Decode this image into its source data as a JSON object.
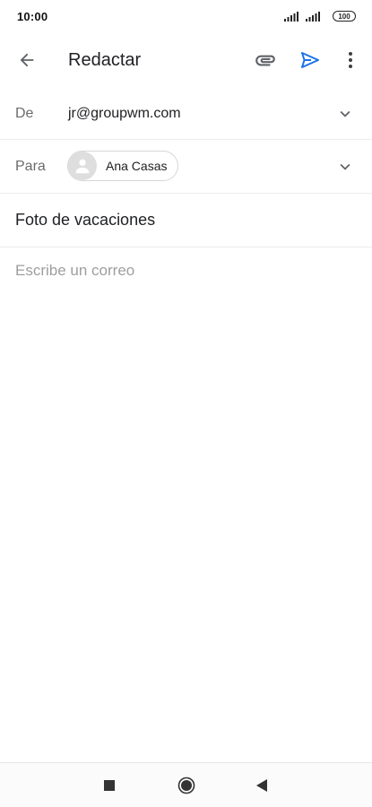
{
  "status_bar": {
    "time": "10:00",
    "battery": "100"
  },
  "app_bar": {
    "title": "Redactar",
    "icons": {
      "back": "arrow-back-icon",
      "attach": "paperclip-icon",
      "send": "send-icon",
      "more": "more-vert-icon"
    },
    "send_color": "#1a73e8"
  },
  "compose": {
    "from_label": "De",
    "from_value": "jr@groupwm.com",
    "to_label": "Para",
    "recipients": [
      {
        "name": "Ana Casas"
      }
    ],
    "subject": "Foto de vacaciones",
    "body_placeholder": "Escribe un correo"
  },
  "nav_bar": {
    "icons": [
      "recents-square-icon",
      "home-circle-icon",
      "back-triangle-icon"
    ]
  }
}
